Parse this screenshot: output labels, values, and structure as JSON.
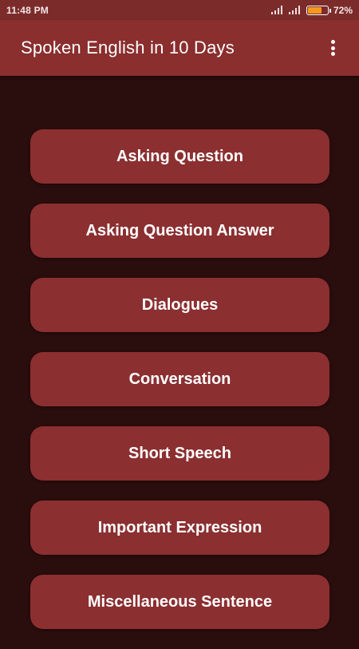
{
  "status_bar": {
    "time": "11:48 PM",
    "battery_percent": 72,
    "battery_text": "72%",
    "signal_icons": [
      "signal-icon",
      "signal-icon"
    ],
    "battery_icon": "battery-icon"
  },
  "app_bar": {
    "title": "Spoken English in 10 Days",
    "overflow_icon": "overflow-menu-icon"
  },
  "menu": {
    "items": [
      {
        "label": "Asking Question"
      },
      {
        "label": "Asking Question Answer"
      },
      {
        "label": "Dialogues"
      },
      {
        "label": "Conversation"
      },
      {
        "label": "Short Speech"
      },
      {
        "label": "Important Expression"
      },
      {
        "label": "Miscellaneous Sentence"
      }
    ]
  },
  "colors": {
    "background": "#2a0d0d",
    "app_bar": "#8a2e2e",
    "status_bar": "#7c2b2b",
    "button": "#8b2f30",
    "battery_fill": "#f39a1e"
  }
}
